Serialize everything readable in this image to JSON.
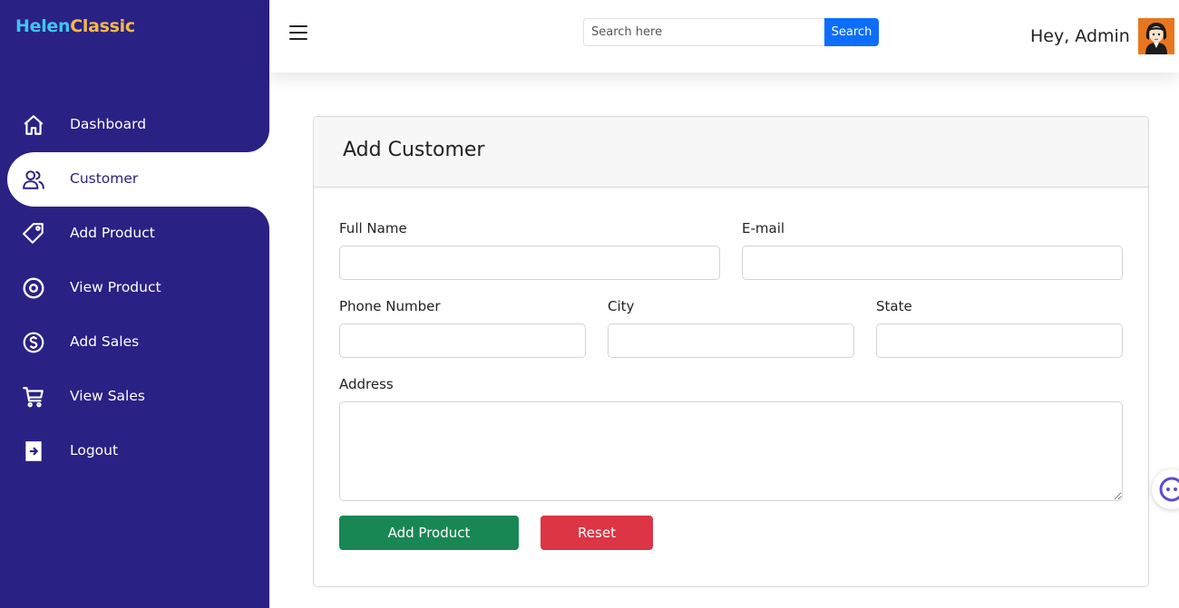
{
  "brand": {
    "part1": "Helen",
    "part2": "Classic"
  },
  "sidebar": {
    "items": [
      {
        "label": "Dashboard",
        "icon": "home-icon"
      },
      {
        "label": "Customer",
        "icon": "users-icon",
        "active": true
      },
      {
        "label": "Add Product",
        "icon": "tag-icon"
      },
      {
        "label": "View Product",
        "icon": "eye-icon"
      },
      {
        "label": "Add Sales",
        "icon": "coin-icon"
      },
      {
        "label": "View Sales",
        "icon": "cart-icon"
      },
      {
        "label": "Logout",
        "icon": "logout-icon"
      }
    ]
  },
  "topbar": {
    "search_placeholder": "Search here",
    "search_button": "Search",
    "greeting": "Hey, Admin"
  },
  "form": {
    "title": "Add Customer",
    "full_name_label": "Full Name",
    "email_label": "E-mail",
    "phone_label": "Phone Number",
    "city_label": "City",
    "state_label": "State",
    "address_label": "Address",
    "submit_label": "Add Product",
    "reset_label": "Reset"
  },
  "colors": {
    "sidebar_bg": "#2a2185",
    "brand_primary": "#3ec6f0",
    "brand_secondary": "#f6b845",
    "search_button": "#0d6efd",
    "submit_button": "#198754",
    "reset_button": "#dc3545"
  }
}
